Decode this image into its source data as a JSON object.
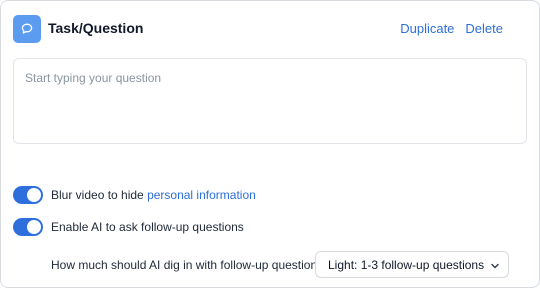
{
  "header": {
    "icon": "chat-bubble-icon",
    "title": "Task/Question",
    "duplicate_label": "Duplicate",
    "delete_label": "Delete"
  },
  "question": {
    "value": "",
    "placeholder": "Start typing your question"
  },
  "blur_toggle": {
    "enabled": true,
    "label_prefix": "Blur video to hide ",
    "label_link": "personal information"
  },
  "ai_toggle": {
    "enabled": true,
    "label": "Enable AI to ask follow-up questions"
  },
  "followup_depth": {
    "label": "How much should AI dig in with follow-up questions?",
    "selected": "Light: 1-3 follow-up questions"
  },
  "colors": {
    "accent": "#2f6fdc",
    "link": "#2d6fd8",
    "icon_bg": "#5b9cf0"
  }
}
